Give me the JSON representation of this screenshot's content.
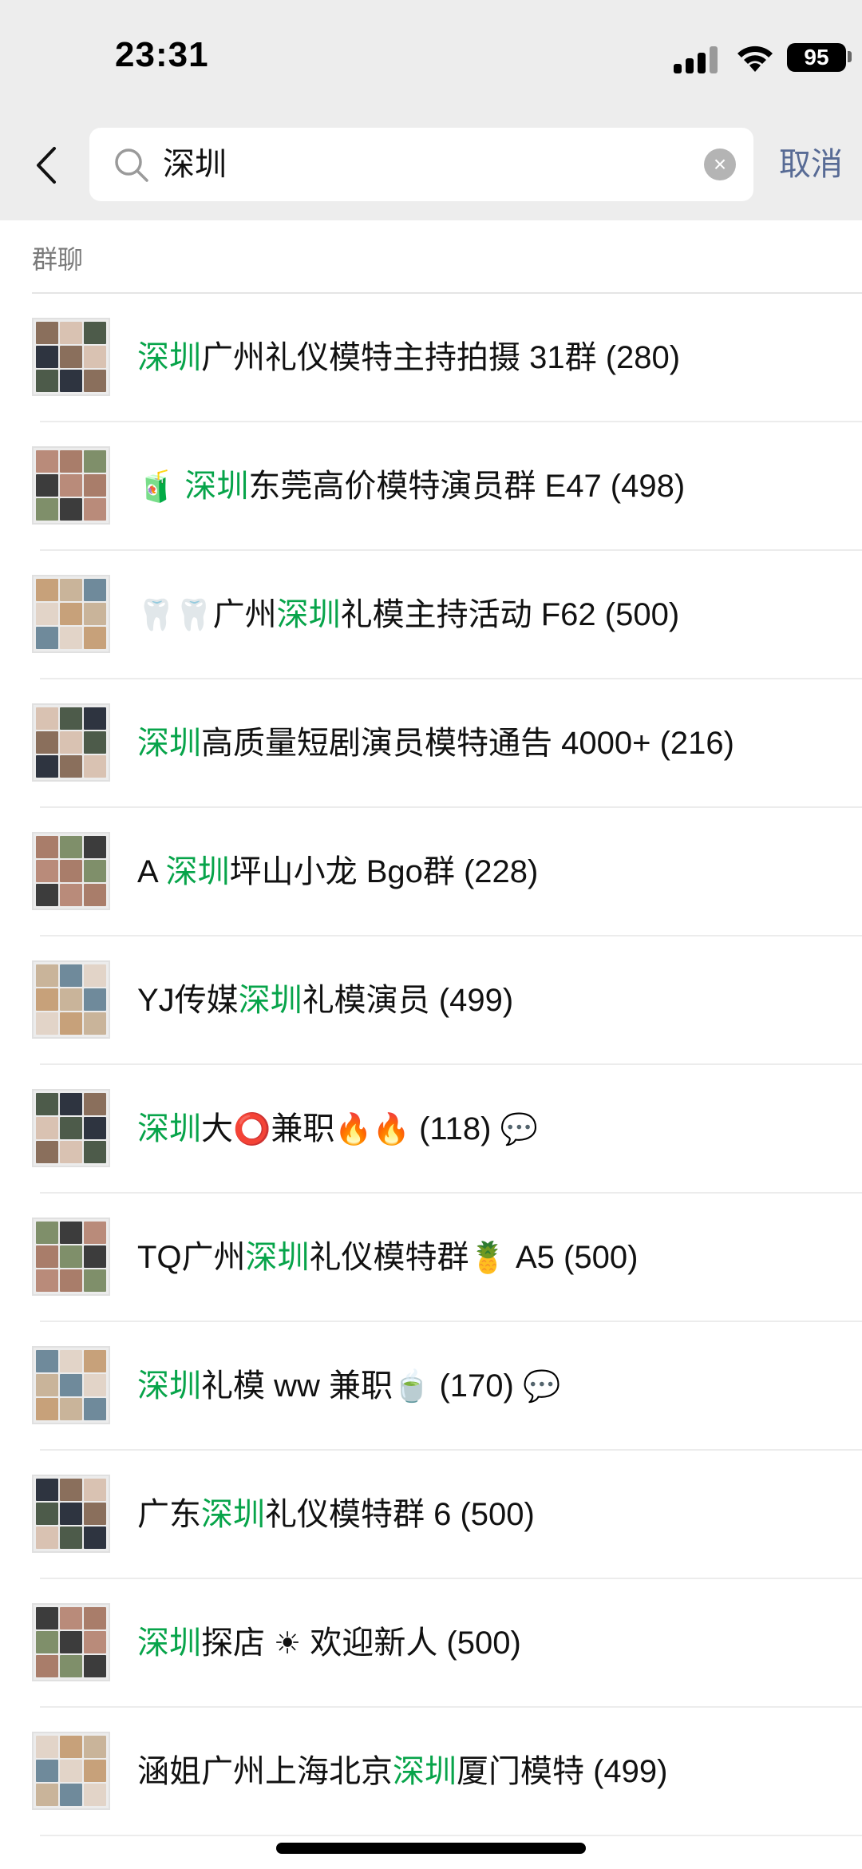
{
  "status": {
    "time": "23:31",
    "battery": "95"
  },
  "search": {
    "query": "深圳",
    "cancel_label": "取消"
  },
  "section_title": "群聊",
  "colors": {
    "highlight": "#07a44a",
    "cancel": "#586b95"
  },
  "results": [
    {
      "parts": [
        {
          "t": "深圳",
          "hl": true
        },
        {
          "t": "广州礼仪模特主持拍摄 31群 (280)"
        }
      ]
    },
    {
      "parts": [
        {
          "t": "🧃 ",
          "emo": true
        },
        {
          "t": "深圳",
          "hl": true
        },
        {
          "t": "东莞高价模特演员群 E47 (498)"
        }
      ]
    },
    {
      "parts": [
        {
          "t": "🦷🦷",
          "emo": true
        },
        {
          "t": "广州"
        },
        {
          "t": "深圳",
          "hl": true
        },
        {
          "t": "礼模主持活动 F62 (500)"
        }
      ]
    },
    {
      "parts": [
        {
          "t": "深圳",
          "hl": true
        },
        {
          "t": "高质量短剧演员模特通告 4000+ (216)"
        }
      ]
    },
    {
      "parts": [
        {
          "t": "A "
        },
        {
          "t": "深圳",
          "hl": true
        },
        {
          "t": "坪山小龙 Bgo群 (228)"
        }
      ]
    },
    {
      "parts": [
        {
          "t": "YJ传媒"
        },
        {
          "t": "深圳",
          "hl": true
        },
        {
          "t": "礼模演员 (499)"
        }
      ]
    },
    {
      "parts": [
        {
          "t": "深圳",
          "hl": true
        },
        {
          "t": "大"
        },
        {
          "t": "⭕",
          "emo": true
        },
        {
          "t": "兼职"
        },
        {
          "t": "🔥🔥",
          "emo": true
        },
        {
          "t": " (118) "
        },
        {
          "t": "💬",
          "emo": true
        }
      ]
    },
    {
      "parts": [
        {
          "t": "TQ广州"
        },
        {
          "t": "深圳",
          "hl": true
        },
        {
          "t": "礼仪模特群"
        },
        {
          "t": "🍍",
          "emo": true
        },
        {
          "t": " A5 (500)"
        }
      ]
    },
    {
      "parts": [
        {
          "t": "深圳",
          "hl": true
        },
        {
          "t": "礼模 ww 兼职"
        },
        {
          "t": "🍵",
          "emo": true
        },
        {
          "t": " (170) "
        },
        {
          "t": "💬",
          "emo": true
        }
      ]
    },
    {
      "parts": [
        {
          "t": "广东"
        },
        {
          "t": "深圳",
          "hl": true
        },
        {
          "t": "礼仪模特群 6 (500)"
        }
      ]
    },
    {
      "parts": [
        {
          "t": "深圳",
          "hl": true
        },
        {
          "t": "探店 "
        },
        {
          "t": "☀",
          "emo": true
        },
        {
          "t": " 欢迎新人 (500)"
        }
      ]
    },
    {
      "parts": [
        {
          "t": "涵姐广州上海北京"
        },
        {
          "t": "深圳",
          "hl": true
        },
        {
          "t": "厦门模特 (499)"
        }
      ]
    }
  ]
}
